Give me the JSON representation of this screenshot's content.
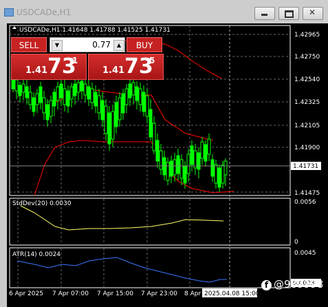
{
  "window": {
    "title": "USDCADe,H1",
    "controls": [
      "minimize",
      "maximize",
      "close"
    ]
  },
  "chart_header": "USDCADe,H1  1.41648 1.41788 1.41525 1.41731",
  "trade_panel": {
    "sell_label": "SELL",
    "buy_label": "BUY",
    "lot_value": "0.77",
    "lot_down_glyph": "▼",
    "lot_up_glyph": "▲",
    "sell_price": {
      "prefix": "1.41",
      "big": "73",
      "sup": "1"
    },
    "buy_price": {
      "prefix": "1.41",
      "big": "73",
      "sup": "5"
    }
  },
  "price_axis": [
    "1.42965",
    "1.42750",
    "1.42540",
    "1.42325",
    "1.42105",
    "1.41900",
    "1.41475"
  ],
  "current_price": "1.41731",
  "stddev": {
    "label": "StdDev(20) 0.0030",
    "axis": [
      "0.0056",
      "0"
    ]
  },
  "atr": {
    "label": "ATR(14) 0.0024",
    "axis": [
      "0.0045",
      "0.0023"
    ]
  },
  "time_axis": [
    "6 Apr 2025",
    "7 Apr 07:00",
    "7 Apr 15:00",
    "7 Apr 23:00",
    "8 Apr"
  ],
  "cursor_time": "2025.04.08 15:00",
  "watermark": "@989998",
  "colors": {
    "candle": "#00ff00",
    "bands": "#ff0000",
    "stddev_line": "#ffff66",
    "atr_line": "#3a78ff",
    "trade_red": "#c62222"
  }
}
